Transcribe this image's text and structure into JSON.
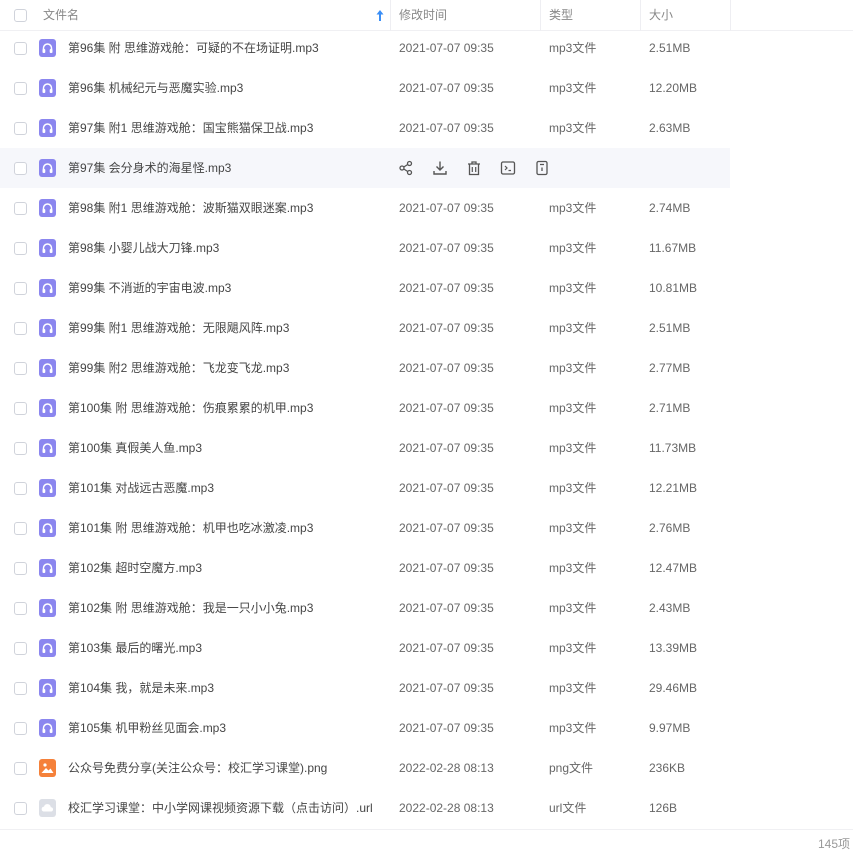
{
  "header": {
    "name_label": "文件名",
    "modified_label": "修改时间",
    "type_label": "类型",
    "size_label": "大小",
    "sort_icon": "arrow-up-icon"
  },
  "files": [
    {
      "name": "第96集 附 思维游戏舱：可疑的不在场证明.mp3",
      "modified": "2021-07-07 09:35",
      "type": "mp3文件",
      "size": "2.51MB",
      "icon": "audio"
    },
    {
      "name": "第96集 机械纪元与恶魔实验.mp3",
      "modified": "2021-07-07 09:35",
      "type": "mp3文件",
      "size": "12.20MB",
      "icon": "audio"
    },
    {
      "name": "第97集 附1 思维游戏舱：国宝熊猫保卫战.mp3",
      "modified": "2021-07-07 09:35",
      "type": "mp3文件",
      "size": "2.63MB",
      "icon": "audio"
    },
    {
      "name": "第97集 会分身术的海星怪.mp3",
      "modified": "",
      "type": "",
      "size": "",
      "icon": "audio",
      "hover": true
    },
    {
      "name": "第98集 附1 思维游戏舱：波斯猫双眼迷案.mp3",
      "modified": "2021-07-07 09:35",
      "type": "mp3文件",
      "size": "2.74MB",
      "icon": "audio"
    },
    {
      "name": "第98集 小婴儿战大刀锋.mp3",
      "modified": "2021-07-07 09:35",
      "type": "mp3文件",
      "size": "11.67MB",
      "icon": "audio"
    },
    {
      "name": "第99集 不消逝的宇宙电波.mp3",
      "modified": "2021-07-07 09:35",
      "type": "mp3文件",
      "size": "10.81MB",
      "icon": "audio"
    },
    {
      "name": "第99集 附1 思维游戏舱：无限飓风阵.mp3",
      "modified": "2021-07-07 09:35",
      "type": "mp3文件",
      "size": "2.51MB",
      "icon": "audio"
    },
    {
      "name": "第99集 附2 思维游戏舱：飞龙变飞龙.mp3",
      "modified": "2021-07-07 09:35",
      "type": "mp3文件",
      "size": "2.77MB",
      "icon": "audio"
    },
    {
      "name": "第100集 附 思维游戏舱：伤痕累累的机甲.mp3",
      "modified": "2021-07-07 09:35",
      "type": "mp3文件",
      "size": "2.71MB",
      "icon": "audio"
    },
    {
      "name": "第100集 真假美人鱼.mp3",
      "modified": "2021-07-07 09:35",
      "type": "mp3文件",
      "size": "11.73MB",
      "icon": "audio"
    },
    {
      "name": "第101集 对战远古恶魔.mp3",
      "modified": "2021-07-07 09:35",
      "type": "mp3文件",
      "size": "12.21MB",
      "icon": "audio"
    },
    {
      "name": "第101集 附 思维游戏舱：机甲也吃冰激凌.mp3",
      "modified": "2021-07-07 09:35",
      "type": "mp3文件",
      "size": "2.76MB",
      "icon": "audio"
    },
    {
      "name": "第102集 超时空魔方.mp3",
      "modified": "2021-07-07 09:35",
      "type": "mp3文件",
      "size": "12.47MB",
      "icon": "audio"
    },
    {
      "name": "第102集 附 思维游戏舱：我是一只小小兔.mp3",
      "modified": "2021-07-07 09:35",
      "type": "mp3文件",
      "size": "2.43MB",
      "icon": "audio"
    },
    {
      "name": "第103集 最后的曙光.mp3",
      "modified": "2021-07-07 09:35",
      "type": "mp3文件",
      "size": "13.39MB",
      "icon": "audio"
    },
    {
      "name": "第104集 我，就是未来.mp3",
      "modified": "2021-07-07 09:35",
      "type": "mp3文件",
      "size": "29.46MB",
      "icon": "audio"
    },
    {
      "name": "第105集 机甲粉丝见面会.mp3",
      "modified": "2021-07-07 09:35",
      "type": "mp3文件",
      "size": "9.97MB",
      "icon": "audio"
    },
    {
      "name": "公众号免费分享(关注公众号：校汇学习课堂).png",
      "modified": "2022-02-28 08:13",
      "type": "png文件",
      "size": "236KB",
      "icon": "image"
    },
    {
      "name": "校汇学习课堂：中小学网课视频资源下载（点击访问）.url",
      "modified": "2022-02-28 08:13",
      "type": "url文件",
      "size": "126B",
      "icon": "url"
    }
  ],
  "hover_actions": [
    "share-icon",
    "download-icon",
    "delete-icon",
    "rename-icon",
    "details-icon"
  ],
  "footer": {
    "count": "145项"
  },
  "colors": {
    "audio_icon": "#8b86ef",
    "image_icon": "#f5813a",
    "url_icon": "#dcdfe6",
    "sort_arrow": "#3a8ef6",
    "hover_row": "#f6f7fb"
  }
}
